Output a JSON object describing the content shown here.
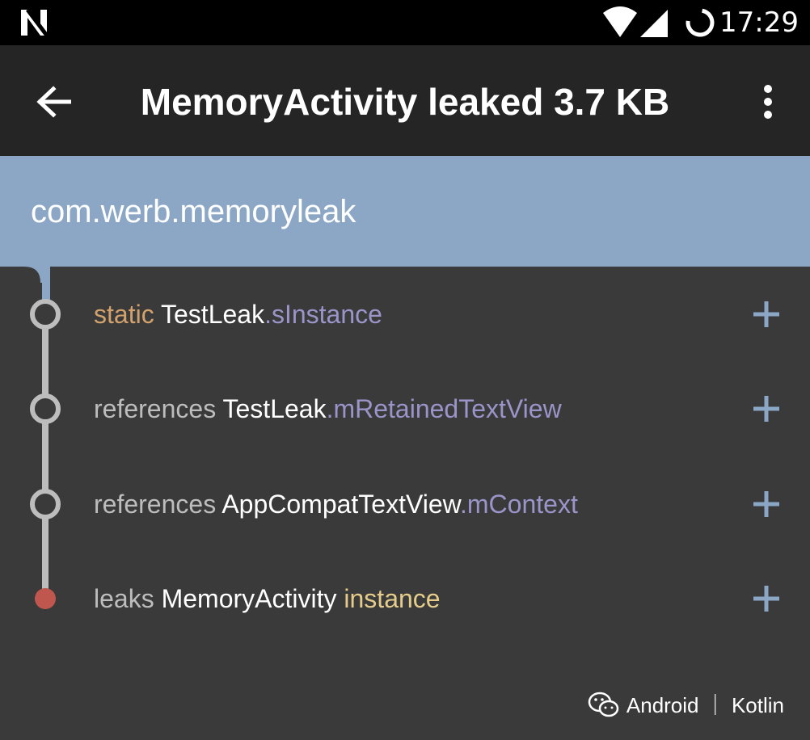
{
  "status_bar": {
    "time": "17:29",
    "icons": [
      "n-notification-icon",
      "wifi-icon",
      "cell-signal-icon",
      "sync-icon"
    ]
  },
  "app_bar": {
    "title": "MemoryActivity leaked 3.7 KB",
    "back_icon": "arrow-left-icon",
    "more_icon": "more-vertical-icon"
  },
  "package": {
    "name": "com.werb.memoryleak"
  },
  "rows": [
    {
      "parts": [
        {
          "text": "static ",
          "tone": "orange"
        },
        {
          "text": "TestLeak",
          "tone": "white"
        },
        {
          "text": ".sInstance",
          "tone": "purple"
        }
      ],
      "node": "hollow"
    },
    {
      "parts": [
        {
          "text": "references ",
          "tone": "gray"
        },
        {
          "text": "TestLeak",
          "tone": "white"
        },
        {
          "text": ".mRetainedTextView",
          "tone": "purple"
        }
      ],
      "node": "hollow"
    },
    {
      "parts": [
        {
          "text": "references ",
          "tone": "gray"
        },
        {
          "text": "AppCompatTextView",
          "tone": "white"
        },
        {
          "text": ".mContext",
          "tone": "purple"
        }
      ],
      "node": "hollow"
    },
    {
      "parts": [
        {
          "text": "leaks ",
          "tone": "gray"
        },
        {
          "text": "MemoryActivity ",
          "tone": "white"
        },
        {
          "text": "instance",
          "tone": "yellow"
        }
      ],
      "node": "filled"
    }
  ],
  "watermark": {
    "text": "Android ｜ Kotlin",
    "icon": "wechat-icon"
  },
  "colors": {
    "app_bar": "#252526",
    "package_header": "#8ca7c6",
    "content_bg": "#3a3a3b",
    "timeline_line": "#bdbdbd",
    "leak_node": "#c0574f",
    "expand_plus": "#8ca7c6"
  }
}
